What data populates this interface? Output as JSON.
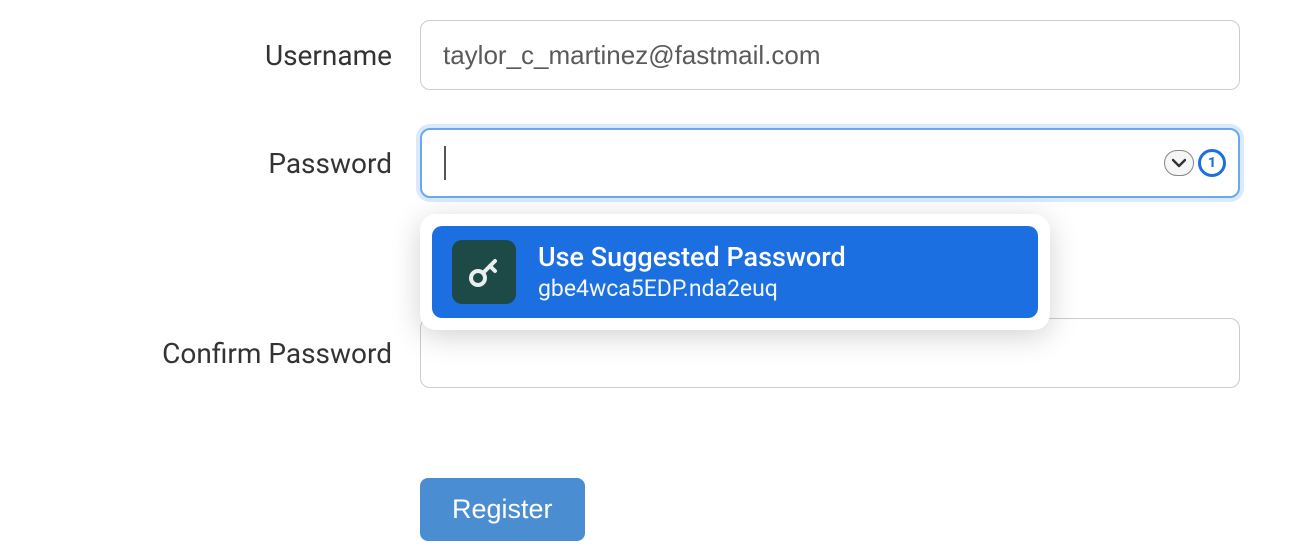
{
  "form": {
    "username": {
      "label": "Username",
      "value": "taylor_c_martinez@fastmail.com"
    },
    "password": {
      "label": "Password",
      "value": ""
    },
    "confirm": {
      "label": "Confirm Password",
      "value": ""
    },
    "submit_label": "Register"
  },
  "password_manager": {
    "suggest_title": "Use Suggested Password",
    "suggested_value": "gbe4wca5EDP.nda2euq",
    "brand_glyph": "1"
  }
}
